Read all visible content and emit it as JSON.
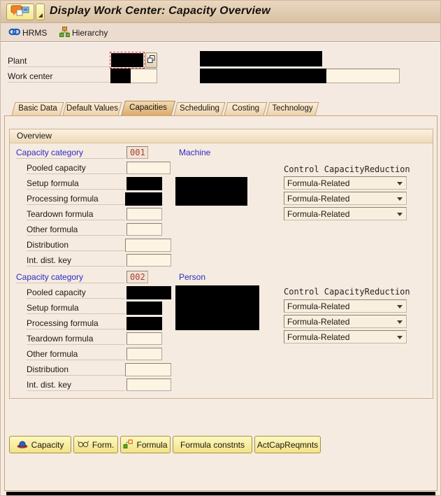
{
  "window": {
    "title": "Display Work Center: Capacity Overview"
  },
  "toolbar": {
    "items": [
      {
        "icon": "link-icon",
        "label": "HRMS"
      },
      {
        "icon": "hierarchy-icon",
        "label": "Hierarchy"
      }
    ]
  },
  "fields": {
    "plant": {
      "label": "Plant"
    },
    "work_center": {
      "label": "Work center"
    }
  },
  "tabs": {
    "items": [
      "Basic Data",
      "Default Values",
      "Capacities",
      "Scheduling",
      "Costing",
      "Technology"
    ],
    "active": "Capacities"
  },
  "overview": {
    "title": "Overview",
    "control_header": "Control CapacityReduction",
    "sections": [
      {
        "category_label": "Capacity category",
        "category_value": "001",
        "category_name": "Machine",
        "rows": [
          "Pooled capacity",
          "Setup formula",
          "Processing formula",
          "Teardown formula",
          "Other formula",
          "Distribution",
          "Int. dist. key"
        ],
        "dropdowns": [
          "Formula-Related",
          "Formula-Related",
          "Formula-Related"
        ]
      },
      {
        "category_label": "Capacity category",
        "category_value": "002",
        "category_name": "Person",
        "rows": [
          "Pooled capacity",
          "Setup formula",
          "Processing formula",
          "Teardown formula",
          "Other formula",
          "Distribution",
          "Int. dist. key"
        ],
        "dropdowns": [
          "Formula-Related",
          "Formula-Related",
          "Formula-Related"
        ]
      }
    ]
  },
  "footer": {
    "buttons": [
      {
        "icon": "capacity-hat-icon",
        "label": "Capacity"
      },
      {
        "icon": "glasses-icon",
        "label": "Form."
      },
      {
        "icon": "formula-icon",
        "label": "Formula"
      },
      {
        "label": "Formula constnts"
      },
      {
        "label": "ActCapReqmnts"
      }
    ]
  },
  "colors": {
    "accent-blue": "#2b2bc4",
    "value-red": "#a3402e",
    "active-tab-tan": "#d8a76a",
    "button-yellow": "#f2e384"
  }
}
